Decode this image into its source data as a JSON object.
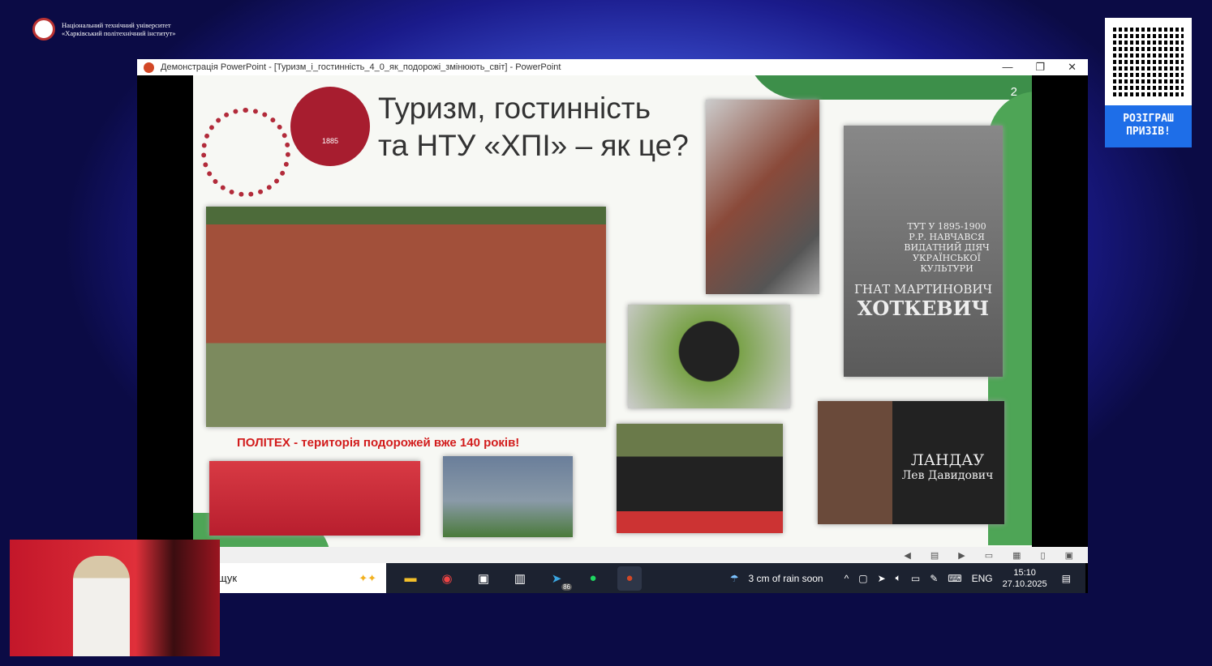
{
  "header": {
    "org_line1": "Національний технічний університет",
    "org_line2": "«Харківський політехнічний інститут»"
  },
  "qr": {
    "button_label": "РОЗІГРАШ ПРИЗІВ!"
  },
  "window": {
    "title": "Демонстрація PowerPoint - [Туризм_і_гостинність_4_0_як_подорожі_змінюють_світ] - PowerPoint",
    "minimize": "—",
    "restore": "❐",
    "close": "✕"
  },
  "slide": {
    "title_line1": "Туризм, гостинність",
    "title_line2": "та НТУ «ХПІ» – як це?",
    "page_number": "2",
    "caption": "ПОЛІТЕХ - територія подорожей вже 140 років!",
    "plaque1": "ТУТ У 1895-1900 Р.Р. НАВЧАВСЯ ВИДАТНИЙ ДІЯЧ УКРАЇНСЬКОЇ КУЛЬТУРИ",
    "plaque1_name1": "ГНАТ МАРТИНОВИЧ",
    "plaque1_name2": "ХОТКЕВИЧ",
    "plaque2_name1": "ЛАНДАУ",
    "plaque2_name2": "Лев Давидович",
    "seal_year": "1885"
  },
  "taskbar": {
    "search_text": "щук",
    "telegram_badge": "86",
    "weather": "3 cm of rain soon",
    "lang": "ENG",
    "time": "15:10",
    "date": "27.10.2025"
  }
}
